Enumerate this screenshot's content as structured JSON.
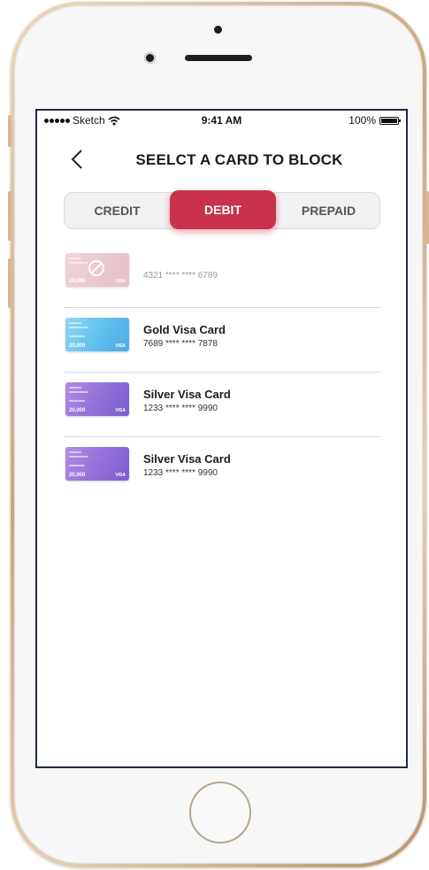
{
  "status_bar": {
    "carrier": "Sketch",
    "time": "9:41 AM",
    "battery": "100%"
  },
  "header": {
    "title": "SEELCT A CARD TO BLOCK"
  },
  "tabs": [
    {
      "label": "CREDIT",
      "active": false
    },
    {
      "label": "DEBIT",
      "active": true
    },
    {
      "label": "PREPAID",
      "active": false
    }
  ],
  "cards": [
    {
      "name": "",
      "number": "4321 **** **** 6789",
      "blocked": true,
      "thumb_amount": "20,000",
      "thumb_brand": "VISA"
    },
    {
      "name": "Gold Visa Card",
      "number": "7689 **** **** 7878",
      "blocked": false,
      "thumb_amount": "20,000",
      "thumb_brand": "VISA"
    },
    {
      "name": "Silver Visa Card",
      "number": "1233 **** **** 9990",
      "blocked": false,
      "thumb_amount": "20,000",
      "thumb_brand": "VISA"
    },
    {
      "name": "Silver Visa Card",
      "number": "1233 **** **** 9990",
      "blocked": false,
      "thumb_amount": "20,000",
      "thumb_brand": "VISA"
    }
  ],
  "colors": {
    "accent": "#c8324a",
    "blocked_card": "#d99aa6",
    "gold_card": "#6ec6ef",
    "silver_card": "#8e6fd6",
    "screen_border": "#1f2a44"
  },
  "icons": {
    "back": "chevron-left-icon",
    "blocked": "block-icon",
    "signal": "signal-dots-icon",
    "wifi": "wifi-icon",
    "battery": "battery-icon"
  }
}
